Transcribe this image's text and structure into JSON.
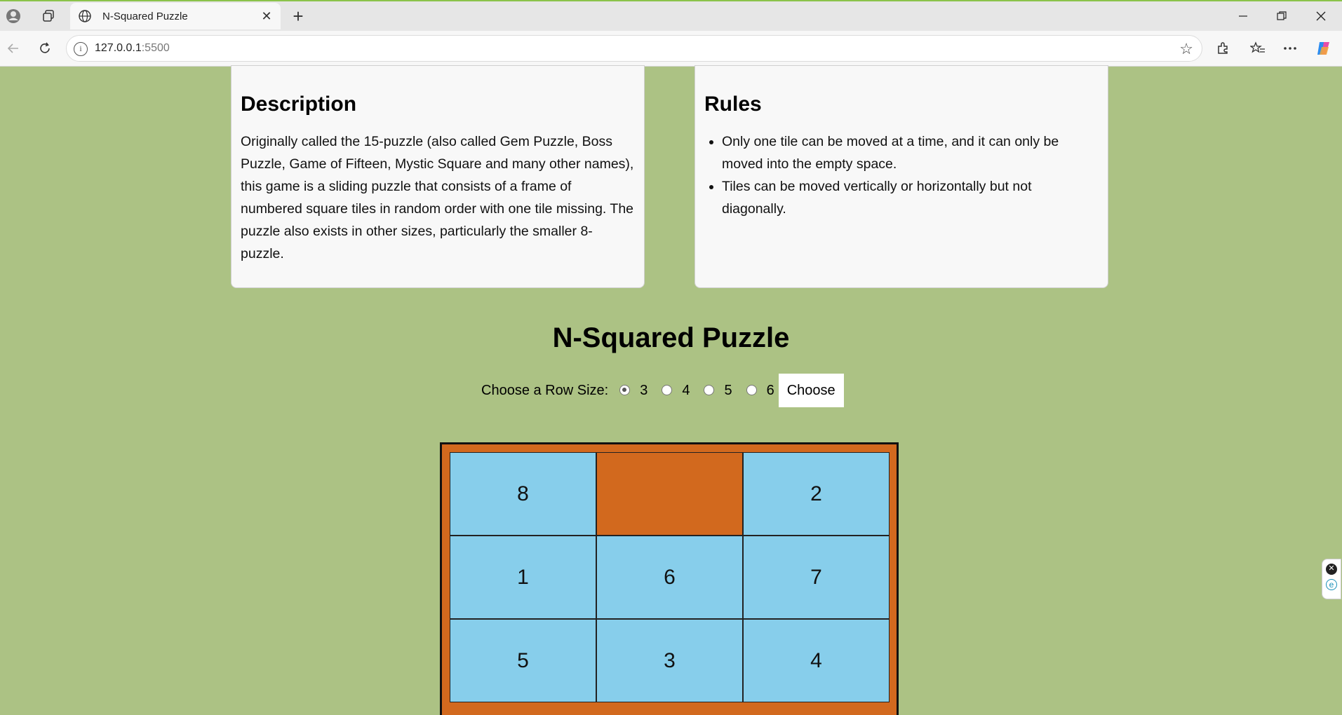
{
  "browser": {
    "tab_title": "N-Squared Puzzle",
    "url_host": "127.0.0.1",
    "url_port": ":5500",
    "close_tab_glyph": "✕",
    "new_tab_glyph": "+"
  },
  "description": {
    "heading": "Description",
    "text": "Originally called the 15-puzzle (also called Gem Puzzle, Boss Puzzle, Game of Fifteen, Mystic Square and many other names), this game is a sliding puzzle that consists of a frame of numbered square tiles in random order with one tile missing. The puzzle also exists in other sizes, particularly the smaller 8-puzzle."
  },
  "rules": {
    "heading": "Rules",
    "items": [
      "Only one tile can be moved at a time, and it can only be moved into the empty space.",
      "Tiles can be moved vertically or horizontally but not diagonally."
    ]
  },
  "puzzle": {
    "title": "N-Squared Puzzle",
    "chooser_label": "Choose a Row Size:",
    "options": [
      "3",
      "4",
      "5",
      "6"
    ],
    "selected_option": "3",
    "choose_button": "Choose",
    "tiles": [
      "8",
      "",
      "2",
      "1",
      "6",
      "7",
      "5",
      "3",
      "4"
    ]
  },
  "colors": {
    "page_background": "#acc284",
    "board_frame": "#d2691e",
    "tile": "#87ceeb",
    "empty_tile": "#d2691e"
  }
}
